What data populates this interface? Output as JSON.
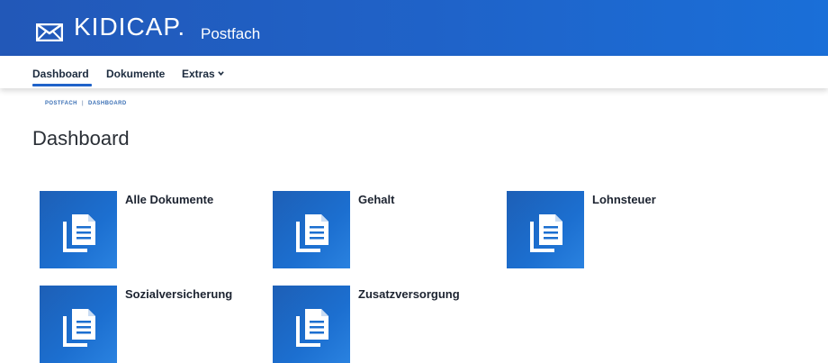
{
  "header": {
    "brand": "KIDICAP.",
    "brand_sub": "Postfach",
    "logo_icon": "envelope-icon"
  },
  "nav": {
    "items": [
      {
        "label": "Dashboard",
        "active": true
      },
      {
        "label": "Dokumente",
        "active": false
      },
      {
        "label": "Extras",
        "active": false,
        "icon": "chevron-down-icon"
      }
    ]
  },
  "breadcrumb": {
    "items": [
      "POSTFACH",
      "DASHBOARD"
    ],
    "separator": "|"
  },
  "page": {
    "title": "Dashboard"
  },
  "tiles": [
    {
      "label": "Alle Dokumente",
      "icon": "documents-icon"
    },
    {
      "label": "Gehalt",
      "icon": "documents-icon"
    },
    {
      "label": "Lohnsteuer",
      "icon": "documents-icon"
    },
    {
      "label": "Sozialversicherung",
      "icon": "documents-icon"
    },
    {
      "label": "Zusatzversorgung",
      "icon": "documents-icon"
    }
  ],
  "colors": {
    "header_blue": "#1f63c9",
    "tile_blue": "#1c6fd0",
    "text_dark": "#1c2330",
    "breadcrumb_blue": "#3a6fb5"
  }
}
